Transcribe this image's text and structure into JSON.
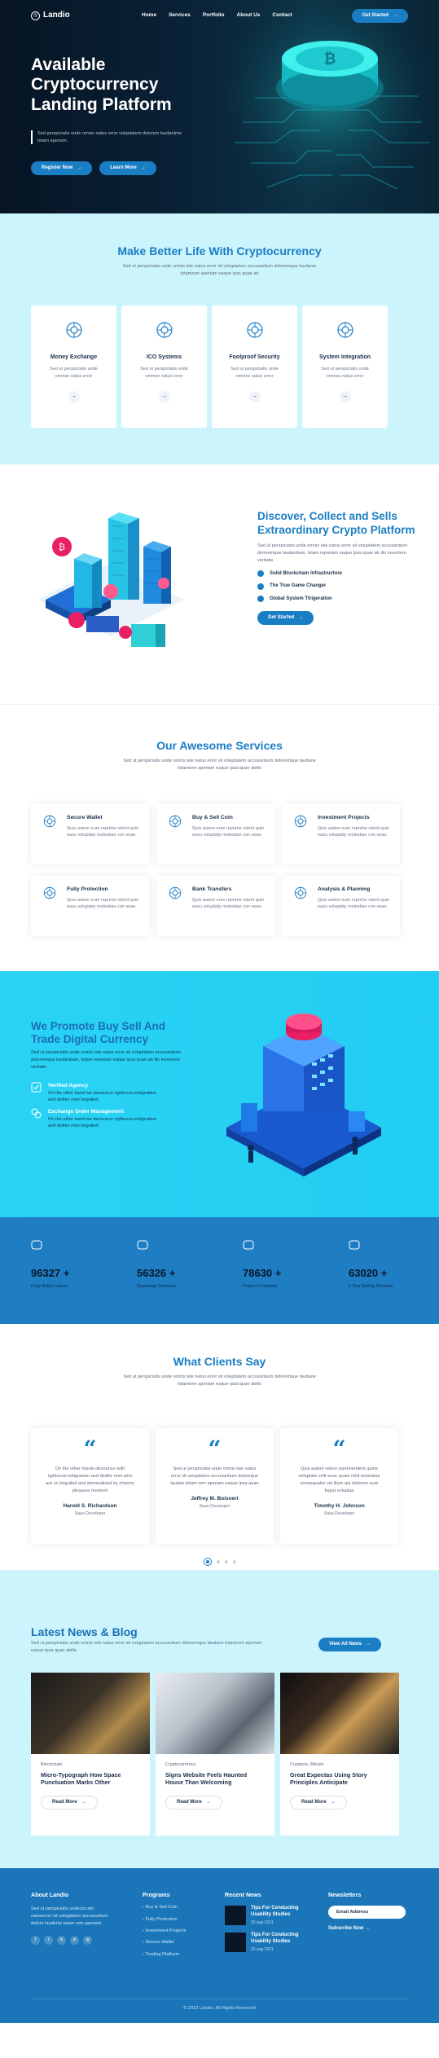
{
  "nav": {
    "logo": "Landio",
    "items": [
      "Home",
      "Services",
      "Portfolio",
      "About Us",
      "Contact"
    ],
    "cta": "Get Started"
  },
  "hero": {
    "title": "Available Cryptocurrency Landing Platform",
    "lead": "Sed perspiciatis unde omnis natus error voluptatem dolorem laudantme totam aperiam.",
    "btn1": "Register Now",
    "btn2": "Learn More"
  },
  "better": {
    "title": "Make Better Life With Cryptocurrency",
    "sub": "Sed ut perspiciatis unde omnis iste natus error sit voluptatem accusantium doloremque laudanw totamrem aperiam eaque ipsa quae ab",
    "cards": [
      {
        "title": "Money Exchange",
        "desc": "Sed ut perspiciatis unde omnise natus error",
        "icon": "coin-exchange-icon"
      },
      {
        "title": "ICO Systems",
        "desc": "Sed ut perspiciatis unde omnise natus error",
        "icon": "network-icon"
      },
      {
        "title": "Foolproof Security",
        "desc": "Sed ut perspiciatis unde omnise natus error",
        "icon": "shield-network-icon"
      },
      {
        "title": "System Integration",
        "desc": "Sed ut perspiciatis unde omnise natus error",
        "icon": "integration-icon"
      }
    ]
  },
  "discover": {
    "title": "Discover, Collect and Sells Extraordinary Crypto Platform",
    "desc": "Sed ut perspiciatis unde omnis iste natus error sit voluptatem accusantium doloremque laudantium, totam reperiam eaque ipsa quae ab illo inventore veritatis",
    "checks": [
      "Solid Blockchain Infrastructure",
      "The True Game Changer",
      "Global System Ttrigeration"
    ],
    "cta": "Get Started"
  },
  "awesome": {
    "title": "Our Awesome Services",
    "sub": "Sed ut perspiciatis unde omnis iste natus error sit voluptatem accusantium doloremque laudane totamrem aperiam eaque ipsa quae abillo",
    "items": [
      {
        "title": "Secure Wallet",
        "desc": "Quis autem eum reprehe nderit quin easu voluptaty molestiae con seae.",
        "icon": "wallet-icon"
      },
      {
        "title": "Buy & Sell Coin",
        "desc": "Quis autem eum reprehe nderit quin easu voluptaty molestiae con seae.",
        "icon": "buy-sell-icon"
      },
      {
        "title": "Investment Projects",
        "desc": "Quis autem eum reprehe nderit quin easu voluptaty molestiae con seae.",
        "icon": "investment-icon"
      },
      {
        "title": "Fully Protection",
        "desc": "Quis autem eum reprehe nderit quin easu voluptaty molestiae con seae.",
        "icon": "protection-icon"
      },
      {
        "title": "Bank Transfers",
        "desc": "Quis autem eum reprehe nderit quin easu voluptaty molestiae con seae.",
        "icon": "transfer-icon"
      },
      {
        "title": "Analysis & Planning",
        "desc": "Quis autem eum reprehe nderit quin easu voluptaty molestiae con seae.",
        "icon": "analysis-icon"
      }
    ]
  },
  "promote": {
    "title": "We Promote Buy Sell And Trade Digital Currency",
    "desc": "Sed ut perspiciatis unde omnis iste natus error sit voluptatem accusantium doloremque laudantium, totam reperiam eaque ipsa quae ab illo inventore veritatis",
    "features": [
      {
        "title": "Verified Agency",
        "desc": "On the other hand we denounce righteous indignation and dislike men beguiled",
        "icon": "verified-icon"
      },
      {
        "title": "Exchange Order Management",
        "desc": "On the other hand we denounce righteous indignation and dislike men beguiled",
        "icon": "exchange-icon"
      }
    ]
  },
  "stats": [
    {
      "num": "96327 +",
      "label": "Daily Active Users",
      "icon": "users-icon"
    },
    {
      "num": "56326 +",
      "label": "Download Software",
      "icon": "cloud-download-icon"
    },
    {
      "num": "78630 +",
      "label": "Project Complete",
      "icon": "document-icon"
    },
    {
      "num": "63020 +",
      "label": "5 Star Rating Reviews",
      "icon": "diamond-icon"
    }
  ],
  "clients": {
    "title": "What Clients Say",
    "sub": "Sed ut perspiciatis unde omnis iste natus error sit voluptatem accusantium doloremque laudane totamrem aperiam eaque ipsa quae abillo",
    "items": [
      {
        "text": "On the other hands denounce with righteous indignation and dislike men who are so beguiled and demoralized by charms pleasure moment",
        "name": "Harold S. Richardson",
        "role": "Saas Developer"
      },
      {
        "text": "Sed ut perspiciatis unde omnis iste natus error sit voluptatem accusantium doloreque laudan totam rem aperiam eaque ipsa quae",
        "name": "Jeffrey M. Boisvert",
        "role": "Saas Developer"
      },
      {
        "text": "Quis autem velum reprehenderit quine voluptate velit esse quam nihil molestiae consequatur vel illum qui dolorem eum fugiat voluptas",
        "name": "Timothy H. Johnson",
        "role": "Saas Developer"
      }
    ]
  },
  "news": {
    "title": "Latest News & Blog",
    "sub": "Sed ut perspiciatis unde omnis iste natus error sit voluptatem accusantium doloremque laudane totamrem aperiam eaque ipsa quae abillo",
    "view_all": "View All News",
    "items": [
      {
        "cat": "Blockchain",
        "title": "Micro-Typograph How Space Punctuation Marks Other",
        "btn": "Read More"
      },
      {
        "cat": "Cryptocurrency",
        "title": "Signs Website Feels Haunted House Than Welcoming",
        "btn": "Read More"
      },
      {
        "cat": "Cryptoes, Bitcoin",
        "title": "Great Expectas Using Story Principles Anticipate",
        "btn": "Read More"
      }
    ]
  },
  "footer": {
    "about_title": "About Landio",
    "about_text": "Sed ut perspiciatis undecis iste natuserror sit voluptatem accusantium dolore laudenis totam rem aperiam",
    "social": [
      "f",
      "t",
      "in",
      "yt",
      "ig"
    ],
    "programs_title": "Programs",
    "programs": [
      "Buy & Sell Coin",
      "Fully Protection",
      "Investment Projects",
      "Secure Wallet",
      "Trading Platform"
    ],
    "recent_title": "Recent News",
    "recent": [
      {
        "title": "Tips For Conducting Usability Studies",
        "date": "25 aug 2021"
      },
      {
        "title": "Tips For Conducting Usability Studies",
        "date": "25 aug 2021"
      }
    ],
    "newsletter_title": "Newsletters",
    "email_placeholder": "Email Address",
    "subscribe": "Subscribe Now",
    "copyright": "© 2022 Landio. All Rights Reserved"
  }
}
